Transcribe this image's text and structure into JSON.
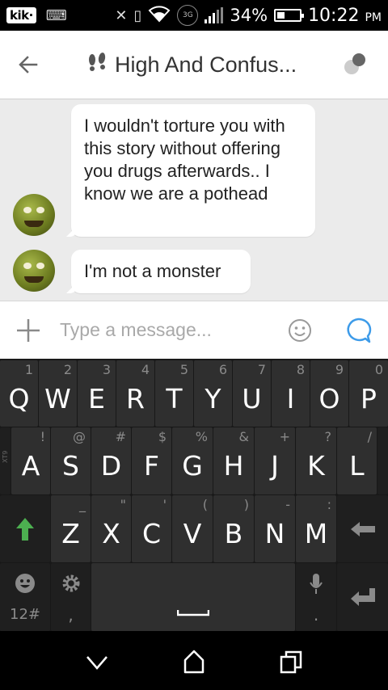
{
  "status_bar": {
    "app_badge": "kik·",
    "network": "3G",
    "battery_percent": "34%",
    "battery_level": 0.34,
    "time": "10:22",
    "meridiem": "PM"
  },
  "header": {
    "title": "High And Confus..."
  },
  "messages": [
    {
      "text": "I wouldn't torture you with this story without offering you drugs afterwards.. I know we are a pothead"
    },
    {
      "text": "I'm not a monster"
    }
  ],
  "input": {
    "placeholder": "Type a message..."
  },
  "keyboard": {
    "row1": [
      {
        "key": "Q",
        "sub": "1"
      },
      {
        "key": "W",
        "sub": "2"
      },
      {
        "key": "E",
        "sub": "3"
      },
      {
        "key": "R",
        "sub": "4"
      },
      {
        "key": "T",
        "sub": "5"
      },
      {
        "key": "Y",
        "sub": "6"
      },
      {
        "key": "U",
        "sub": "7"
      },
      {
        "key": "I",
        "sub": "8"
      },
      {
        "key": "O",
        "sub": "9"
      },
      {
        "key": "P",
        "sub": "0"
      }
    ],
    "row2": [
      {
        "key": "A",
        "sub": "!"
      },
      {
        "key": "S",
        "sub": "@"
      },
      {
        "key": "D",
        "sub": "#"
      },
      {
        "key": "F",
        "sub": "$"
      },
      {
        "key": "G",
        "sub": "%"
      },
      {
        "key": "H",
        "sub": "&"
      },
      {
        "key": "J",
        "sub": "+"
      },
      {
        "key": "K",
        "sub": "?"
      },
      {
        "key": "L",
        "sub": "/"
      }
    ],
    "row3": [
      {
        "key": "Z",
        "sub": "_"
      },
      {
        "key": "X",
        "sub": "\""
      },
      {
        "key": "C",
        "sub": "'"
      },
      {
        "key": "V",
        "sub": "("
      },
      {
        "key": "B",
        "sub": ")"
      },
      {
        "key": "N",
        "sub": "-"
      },
      {
        "key": "M",
        "sub": ":"
      }
    ],
    "side_tag": "XT9",
    "symbols_label": "12#",
    "comma_label": ",",
    "period_label": "."
  }
}
